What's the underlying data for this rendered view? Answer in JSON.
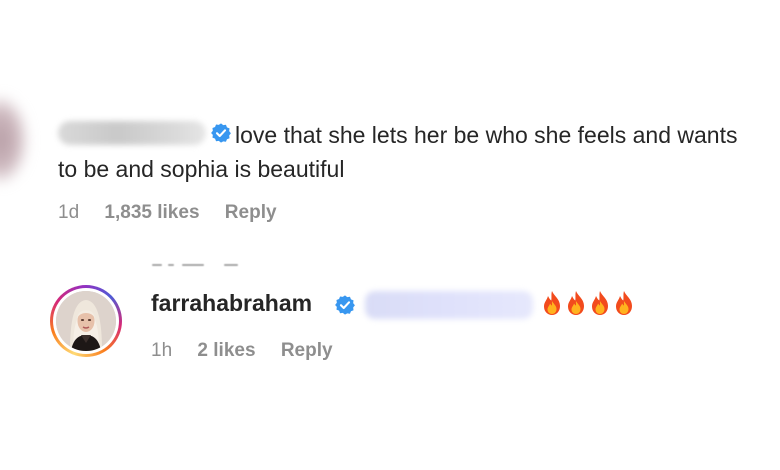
{
  "comment1": {
    "text": "love that she lets her be who she feels and wants to be and sophia is beautiful",
    "age": "1d",
    "likes": "1,835 likes",
    "reply_label": "Reply"
  },
  "comment2": {
    "username": "farrahabraham",
    "emoji_icon": "fire-icon",
    "emoji_count": 4,
    "age": "1h",
    "likes": "2 likes",
    "reply_label": "Reply"
  },
  "colors": {
    "verified_blue": "#3897f0",
    "meta_gray": "#8e8e8e",
    "text": "#262626"
  }
}
